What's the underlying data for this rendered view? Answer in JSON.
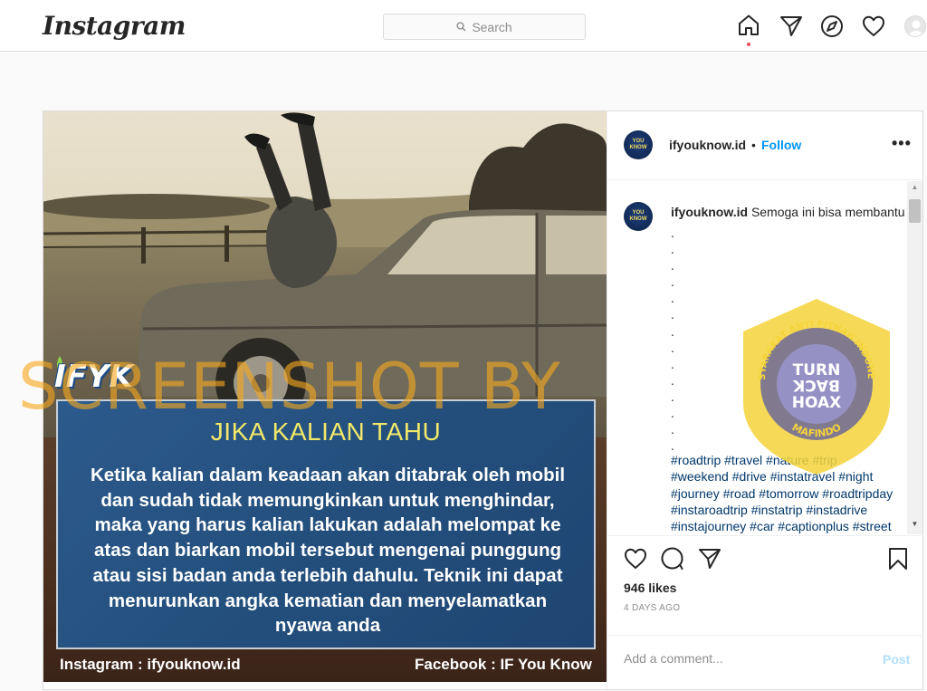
{
  "nav": {
    "logo": "Instagram",
    "search_placeholder": "Search",
    "icons": [
      "home-icon",
      "direct-icon",
      "explore-icon",
      "activity-heart-icon",
      "profile-avatar"
    ],
    "colors": {
      "notification_dot": "#ed4956"
    }
  },
  "post": {
    "image": {
      "brand": "IFYK",
      "title": "JIKA KALIAN TAHU",
      "body": "Ketika kalian dalam keadaan akan ditabrak oleh mobil dan sudah tidak memungkinkan untuk menghindar, maka yang harus kalian lakukan adalah melompat ke atas dan biarkan mobil tersebut mengenai punggung atau sisi badan anda terlebih dahulu. Teknik ini dapat menurunkan angka kematian dan menyelamatkan nyawa anda",
      "credit_left": "Instagram : ifyouknow.id",
      "credit_right": "Facebook : IF You Know",
      "avatar_text_line1": "YOU",
      "avatar_text_line2": "KNOW"
    },
    "header": {
      "username": "ifyouknow.id",
      "separator": "•",
      "follow_label": "Follow",
      "more_label": "•••"
    },
    "caption": {
      "username": "ifyouknow.id",
      "text": "Semoga ini bisa membantu",
      "dots": [
        ".",
        ".",
        ".",
        ".",
        ".",
        ".",
        ".",
        ".",
        ".",
        ".",
        ".",
        ".",
        ".",
        "."
      ],
      "hashtags": [
        "#roadtrip #travel #nature #trip",
        "#weekend #drive #instatravel #night",
        "#journey #road #tomorrow #roadtripday",
        "#instaroadtrip #instatrip #instadrive",
        "#instajourney #car #captionplus #street"
      ]
    },
    "actions": {
      "icons": [
        "like-icon",
        "comment-icon",
        "share-icon",
        "save-icon"
      ],
      "likes": "946 likes",
      "time_ago": "4 DAYS AGO"
    },
    "comment": {
      "placeholder": "Add a comment...",
      "post_label": "Post"
    }
  },
  "overlays": {
    "watermark_text": "SCREENSHOT BY",
    "seal": {
      "top_arc": "MASYARAKAT ANTI FITNAH INDONESIA",
      "bottom_arc": "MAFINDO",
      "line1": "TURN",
      "line2": "BACK",
      "line3": "HOAX",
      "colors": {
        "shield": "#f5d33a",
        "ring": "#5a5aa0",
        "inner": "#9a95cf"
      }
    }
  }
}
